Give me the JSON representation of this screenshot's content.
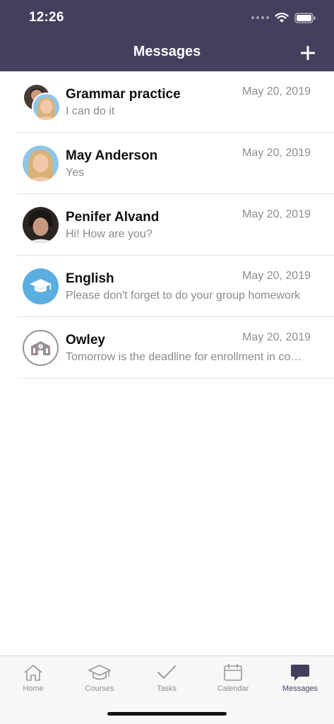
{
  "status": {
    "time": "12:26"
  },
  "header": {
    "title": "Messages",
    "add_icon": "plus-icon"
  },
  "conversations": [
    {
      "name": "Grammar practice",
      "preview": "I can do it",
      "date": "May 20, 2019",
      "avatar": "group-photo-avatar"
    },
    {
      "name": "May Anderson",
      "preview": "Yes",
      "date": "May 20, 2019",
      "avatar": "photo-avatar"
    },
    {
      "name": "Penifer Alvand",
      "preview": "Hi! How are you?",
      "date": "May 20, 2019",
      "avatar": "photo-avatar"
    },
    {
      "name": "English",
      "preview": "Please don't forget to do your group homework",
      "date": "May 20, 2019",
      "avatar": "graduation-cap-icon",
      "avatar_color": "#5aaee0"
    },
    {
      "name": "Owley",
      "preview": "Tomorrow is the deadline for enrollment in courses",
      "date": "May 20, 2019",
      "avatar": "school-building-icon"
    }
  ],
  "tabs": [
    {
      "label": "Home",
      "icon": "home-icon",
      "active": false
    },
    {
      "label": "Courses",
      "icon": "graduation-cap-icon",
      "active": false
    },
    {
      "label": "Tasks",
      "icon": "checkmark-icon",
      "active": false
    },
    {
      "label": "Calendar",
      "icon": "calendar-icon",
      "active": false
    },
    {
      "label": "Messages",
      "icon": "chat-bubble-icon",
      "active": true
    }
  ],
  "colors": {
    "header_bg": "#443f5c",
    "accent": "#443f5c",
    "english_avatar": "#5aaee0"
  }
}
